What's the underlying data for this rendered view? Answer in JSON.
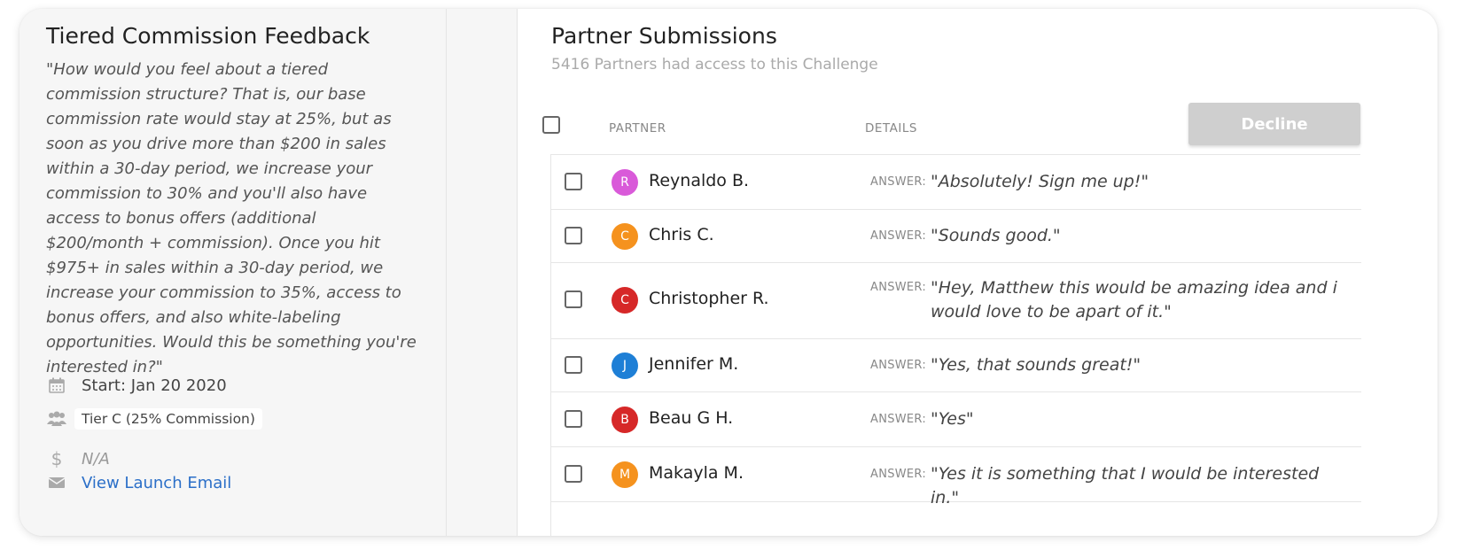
{
  "challenge": {
    "title": "Tiered Commission Feedback",
    "question": "\"How would you feel about a tiered commission structure? That is, our base commission rate would stay at 25%, but as soon as you drive more than $200 in sales within a 30-day period, we increase your commission to 30% and you'll also have access to bonus offers (additional $200/month + commission). Once you hit $975+ in sales within a 30-day period, we increase your commission to 35%, access to bonus offers, and also white-labeling opportunities. Would this be something you're interested in?\"",
    "start_label": "Start: Jan 20 2020",
    "tier_label": "Tier C (25% Commission)",
    "reward_value": "N/A",
    "launch_email_link": "View Launch Email",
    "icons": {
      "start": "calendar-icon",
      "tier": "group-icon",
      "reward": "dollar-icon",
      "email": "envelope-icon"
    }
  },
  "submissions": {
    "title": "Partner Submissions",
    "subtitle": "5416 Partners had access to this Challenge",
    "columns": {
      "partner": "PARTNER",
      "details": "DETAILS"
    },
    "decline_label": "Decline",
    "answer_label": "ANSWER:",
    "rows": [
      {
        "initial": "R",
        "name": "Reynaldo B.",
        "answer": "\"Absolutely! Sign me up!\"",
        "color": "#d95ad9"
      },
      {
        "initial": "C",
        "name": "Chris C.",
        "answer": "\"Sounds good.\"",
        "color": "#f5921e"
      },
      {
        "initial": "C",
        "name": "Christopher R.",
        "answer": "\"Hey, Matthew this would be amazing idea and i would love to be apart of it.\"",
        "color": "#d62828"
      },
      {
        "initial": "J",
        "name": "Jennifer M.",
        "answer": "\"Yes, that sounds great!\"",
        "color": "#1e7fd6"
      },
      {
        "initial": "B",
        "name": "Beau G H.",
        "answer": "\"Yes\"",
        "color": "#d62828"
      },
      {
        "initial": "M",
        "name": "Makayla M.",
        "answer": "\"Yes it is something that I would be interested in.\"",
        "color": "#f5921e"
      }
    ]
  },
  "colors": {
    "accent_link": "#2b6fc8",
    "decline_disabled": "#cfcfcf"
  }
}
